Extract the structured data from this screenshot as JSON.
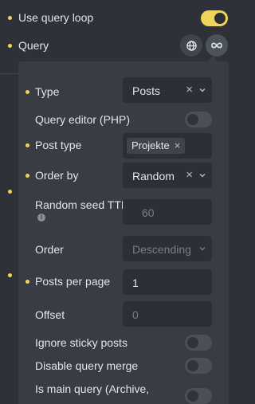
{
  "top": {
    "use_query_loop_label": "Use query loop",
    "use_query_loop_on": true,
    "query_label": "Query"
  },
  "icons": {
    "globe": "globe-icon",
    "infinity": "infinity-icon"
  },
  "panel": {
    "type_label": "Type",
    "type_value": "Posts",
    "query_editor_label": "Query editor (PHP)",
    "post_type_label": "Post type",
    "post_type_tag": "Projekte",
    "order_by_label": "Order by",
    "order_by_value": "Random",
    "random_seed_label": "Random seed TTL",
    "random_seed_placeholder": "60",
    "order_label": "Order",
    "order_value": "Descending",
    "posts_per_page_label": "Posts per page",
    "posts_per_page_value": "1",
    "offset_label": "Offset",
    "offset_placeholder": "0",
    "ignore_sticky_label": "Ignore sticky posts",
    "disable_merge_label": "Disable query merge",
    "is_main_query_label": "Is main query (Archive,"
  },
  "colors": {
    "accent": "#efd35a",
    "panel_bg": "#383c43",
    "page_bg": "#2e3238",
    "field_bg": "#2c2f35"
  }
}
